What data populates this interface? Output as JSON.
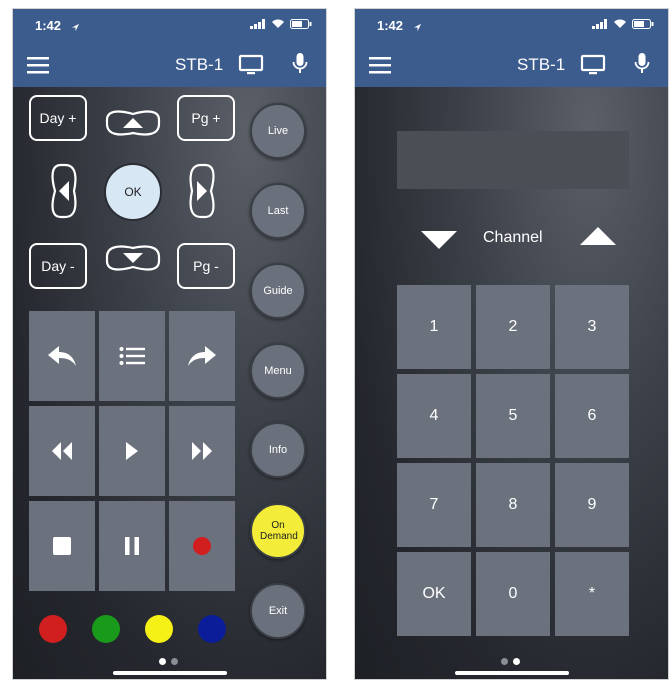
{
  "status": {
    "time": "1:42"
  },
  "nav": {
    "device": "STB-1"
  },
  "remote": {
    "day_plus": "Day +",
    "day_minus": "Day -",
    "pg_plus": "Pg +",
    "pg_minus": "Pg -",
    "ok": "OK",
    "side_buttons": [
      "Live",
      "Last",
      "Guide",
      "Menu",
      "Info",
      "On Demand",
      "Exit"
    ]
  },
  "colors": {
    "red": "#d11f1f",
    "green": "#1a9a1a",
    "yellow": "#f5f015",
    "blue": "#0c1d9a",
    "on_demand": "#f3ec38",
    "navbar": "#3c5c8e"
  },
  "keypad": {
    "channel_label": "Channel",
    "keys": [
      "1",
      "2",
      "3",
      "4",
      "5",
      "6",
      "7",
      "8",
      "9",
      "OK",
      "0",
      "*"
    ]
  },
  "pager": {
    "active_page_left": 1,
    "active_page_right": 2
  }
}
